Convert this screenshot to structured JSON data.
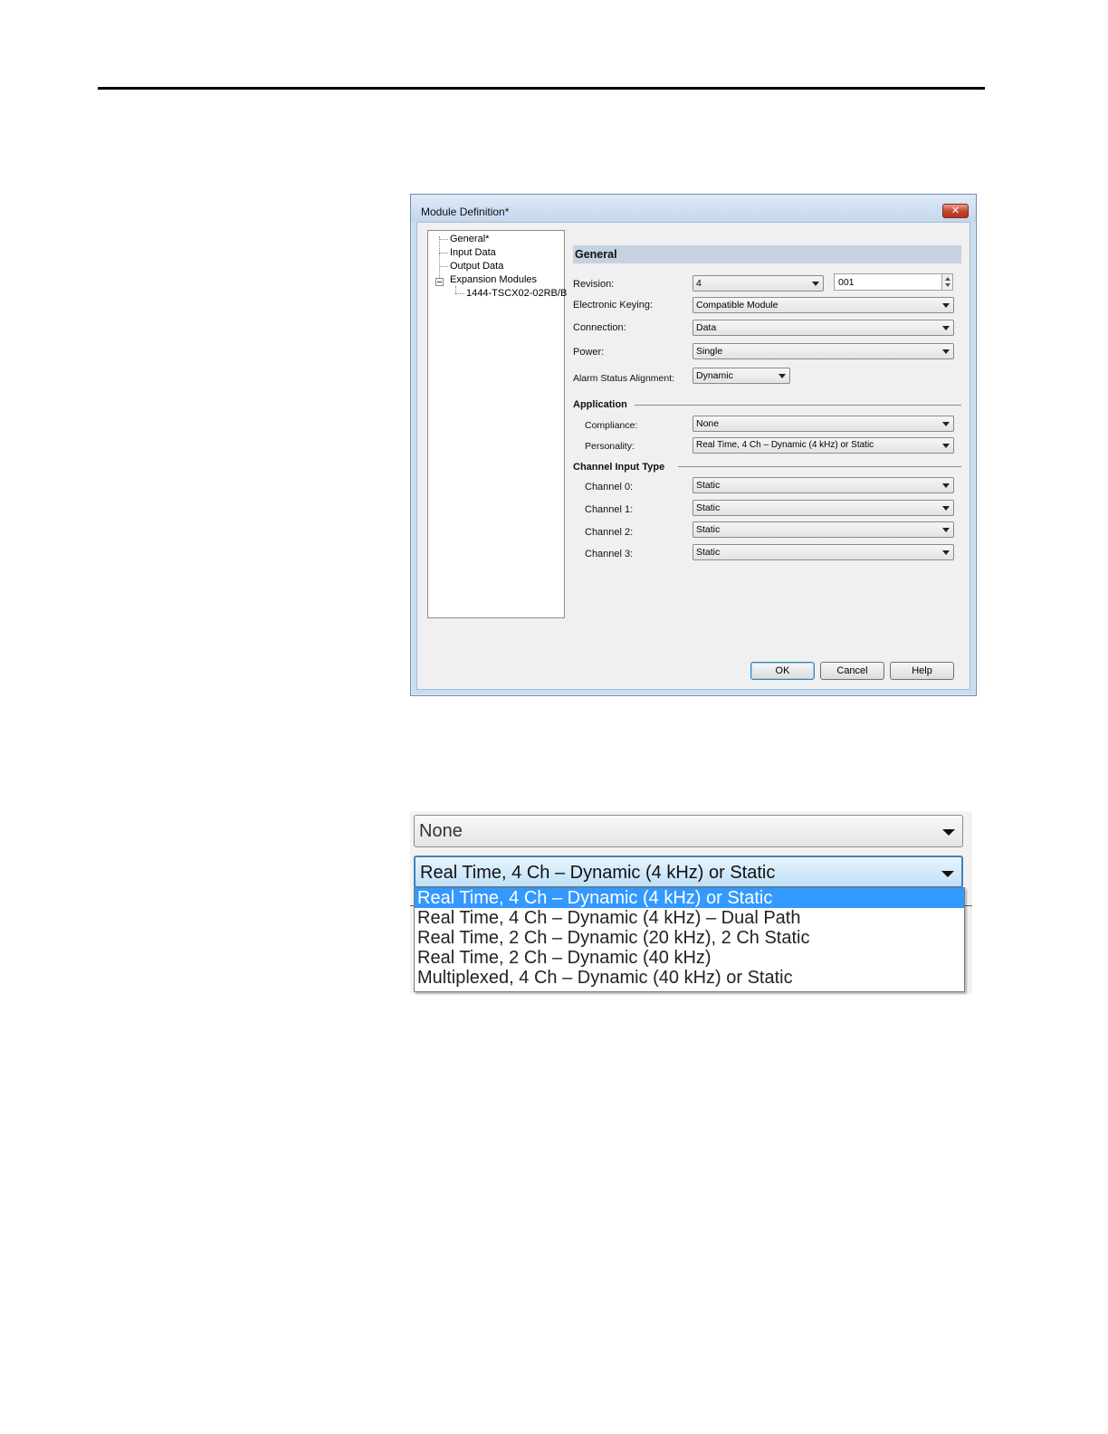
{
  "dialog": {
    "title": "Module Definition*",
    "close_label": "✕",
    "tree": {
      "items": [
        "General*",
        "Input Data",
        "Output Data",
        "Expansion Modules"
      ],
      "child": "1444-TSCX02-02RB/B",
      "expander": "⊟"
    },
    "section_title": "General",
    "revision": {
      "label": "Revision:",
      "major": "4",
      "minor": "001"
    },
    "electronic_keying": {
      "label": "Electronic Keying:",
      "value": "Compatible Module"
    },
    "connection": {
      "label": "Connection:",
      "value": "Data"
    },
    "power": {
      "label": "Power:",
      "value": "Single"
    },
    "alarm_status_alignment": {
      "label": "Alarm Status Alignment:",
      "value": "Dynamic"
    },
    "application": {
      "title": "Application",
      "compliance": {
        "label": "Compliance:",
        "value": "None"
      },
      "personality": {
        "label": "Personality:",
        "value": "Real Time, 4 Ch – Dynamic (4 kHz) or Static"
      }
    },
    "channel_input_type": {
      "title": "Channel Input Type",
      "channels": [
        {
          "label": "Channel 0:",
          "value": "Static"
        },
        {
          "label": "Channel 1:",
          "value": "Static"
        },
        {
          "label": "Channel 2:",
          "value": "Static"
        },
        {
          "label": "Channel 3:",
          "value": "Static"
        }
      ]
    },
    "buttons": {
      "ok": "OK",
      "cancel": "Cancel",
      "help": "Help"
    }
  },
  "zoom": {
    "compliance_value": "None",
    "personality_value": "Real Time, 4 Ch – Dynamic (4 kHz) or Static",
    "options": [
      "Real Time, 4 Ch – Dynamic (4 kHz) or Static",
      "Real Time, 4 Ch – Dynamic (4 kHz) – Dual Path",
      "Real Time, 2 Ch – Dynamic (20 kHz), 2 Ch Static",
      "Real Time, 2 Ch – Dynamic (40 kHz)",
      "Multiplexed, 4 Ch – Dynamic (40 kHz) or Static"
    ],
    "selected_index": 0
  }
}
